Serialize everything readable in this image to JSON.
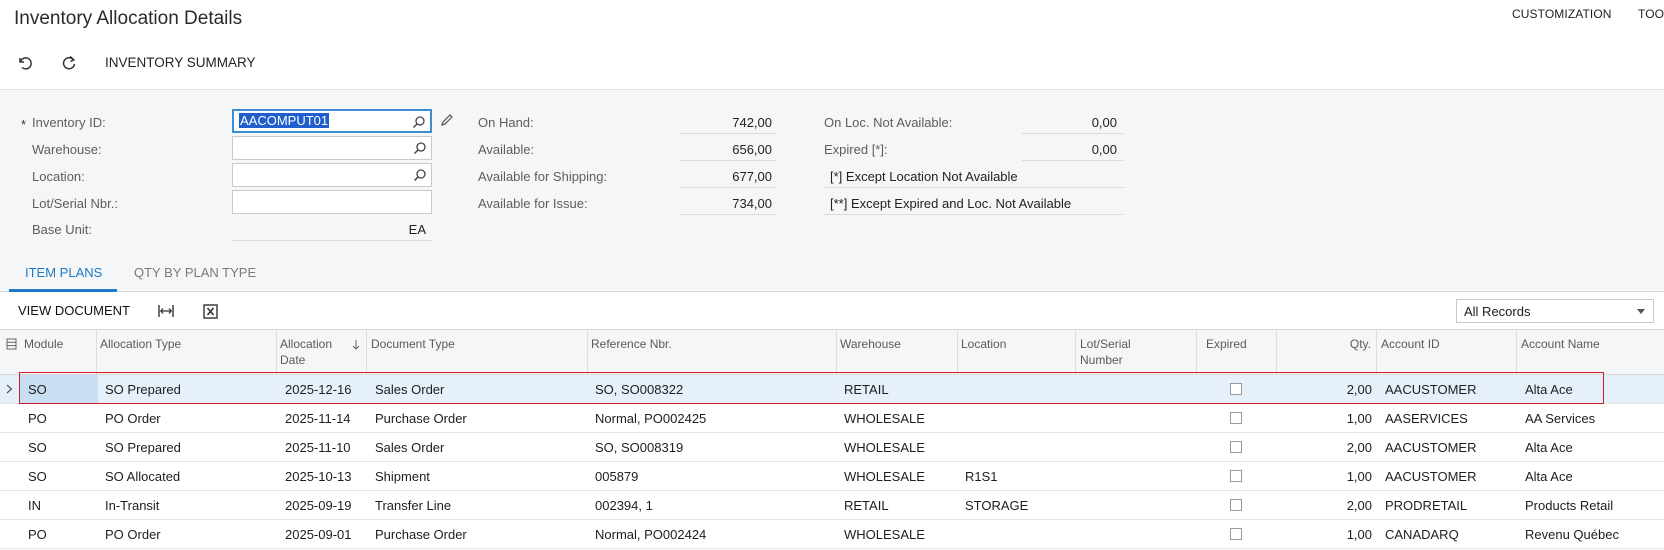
{
  "header": {
    "title": "Inventory Allocation Details",
    "nav": [
      "CUSTOMIZATION",
      "TOO"
    ]
  },
  "toolbar": {
    "undo_icon": "undo-icon",
    "refresh_icon": "refresh-icon",
    "summary_label": "INVENTORY SUMMARY"
  },
  "form": {
    "required_marker": "*",
    "inventory_id_label": "Inventory ID:",
    "inventory_id_value": "AACOMPUT01",
    "warehouse_label": "Warehouse:",
    "warehouse_value": "",
    "location_label": "Location:",
    "location_value": "",
    "lot_label": "Lot/Serial Nbr.:",
    "lot_value": "",
    "base_unit_label": "Base Unit:",
    "base_unit_value": "EA",
    "on_hand_label": "On Hand:",
    "on_hand_value": "742,00",
    "available_label": "Available:",
    "available_value": "656,00",
    "avail_shipping_label": "Available for Shipping:",
    "avail_shipping_value": "677,00",
    "avail_issue_label": "Available for Issue:",
    "avail_issue_value": "734,00",
    "on_loc_na_label": "On Loc. Not Available:",
    "on_loc_na_value": "0,00",
    "expired_label": "Expired [*]:",
    "expired_value": "0,00",
    "note1": "[*]  Except Location Not Available",
    "note2": "[**] Except Expired and  Loc. Not Available"
  },
  "tabs": [
    {
      "label": "ITEM PLANS",
      "active": true
    },
    {
      "label": "QTY BY PLAN TYPE",
      "active": false
    }
  ],
  "grid_toolbar": {
    "view_document": "VIEW DOCUMENT",
    "fit_icon": "fit-columns-icon",
    "export_icon": "excel-export-icon",
    "filter_value": "All Records"
  },
  "grid": {
    "columns": {
      "module": "Module",
      "alloc_type": "Allocation Type",
      "alloc_date": "Allocation Date",
      "alloc_date_line1": "Allocation",
      "alloc_date_line2": "Date",
      "doc_type": "Document Type",
      "ref_nbr": "Reference Nbr.",
      "warehouse": "Warehouse",
      "location": "Location",
      "lot_line1": "Lot/Serial",
      "lot_line2": "Number",
      "expired": "Expired",
      "qty": "Qty.",
      "account_id": "Account ID",
      "account_name": "Account Name"
    },
    "rows": [
      {
        "module": "SO",
        "alloc_type": "SO Prepared",
        "date": "2025-12-16",
        "doc_type": "Sales Order",
        "ref": "SO, SO008322",
        "warehouse": "RETAIL",
        "location": "",
        "qty": "2,00",
        "account_id": "AACUSTOMER",
        "account_name": "Alta Ace"
      },
      {
        "module": "PO",
        "alloc_type": "PO Order",
        "date": "2025-11-14",
        "doc_type": "Purchase Order",
        "ref": "Normal, PO002425",
        "warehouse": "WHOLESALE",
        "location": "",
        "qty": "1,00",
        "account_id": "AASERVICES",
        "account_name": "AA Services"
      },
      {
        "module": "SO",
        "alloc_type": "SO Prepared",
        "date": "2025-11-10",
        "doc_type": "Sales Order",
        "ref": "SO, SO008319",
        "warehouse": "WHOLESALE",
        "location": "",
        "qty": "2,00",
        "account_id": "AACUSTOMER",
        "account_name": "Alta Ace"
      },
      {
        "module": "SO",
        "alloc_type": "SO Allocated",
        "date": "2025-10-13",
        "doc_type": "Shipment",
        "ref": "005879",
        "warehouse": "WHOLESALE",
        "location": "R1S1",
        "qty": "1,00",
        "account_id": "AACUSTOMER",
        "account_name": "Alta Ace"
      },
      {
        "module": "IN",
        "alloc_type": "In-Transit",
        "date": "2025-09-19",
        "doc_type": "Transfer Line",
        "ref": "002394, 1",
        "warehouse": "RETAIL",
        "location": "STORAGE",
        "qty": "2,00",
        "account_id": "PRODRETAIL",
        "account_name": "Products Retail"
      },
      {
        "module": "PO",
        "alloc_type": "PO Order",
        "date": "2025-09-01",
        "doc_type": "Purchase Order",
        "ref": "Normal, PO002424",
        "warehouse": "WHOLESALE",
        "location": "",
        "qty": "1,00",
        "account_id": "CANADARQ",
        "account_name": "Revenu Québec"
      }
    ]
  },
  "colors": {
    "accent": "#1c7ac7",
    "selection_border": "#d11c2a",
    "selected_row": "#e5f0fa"
  }
}
